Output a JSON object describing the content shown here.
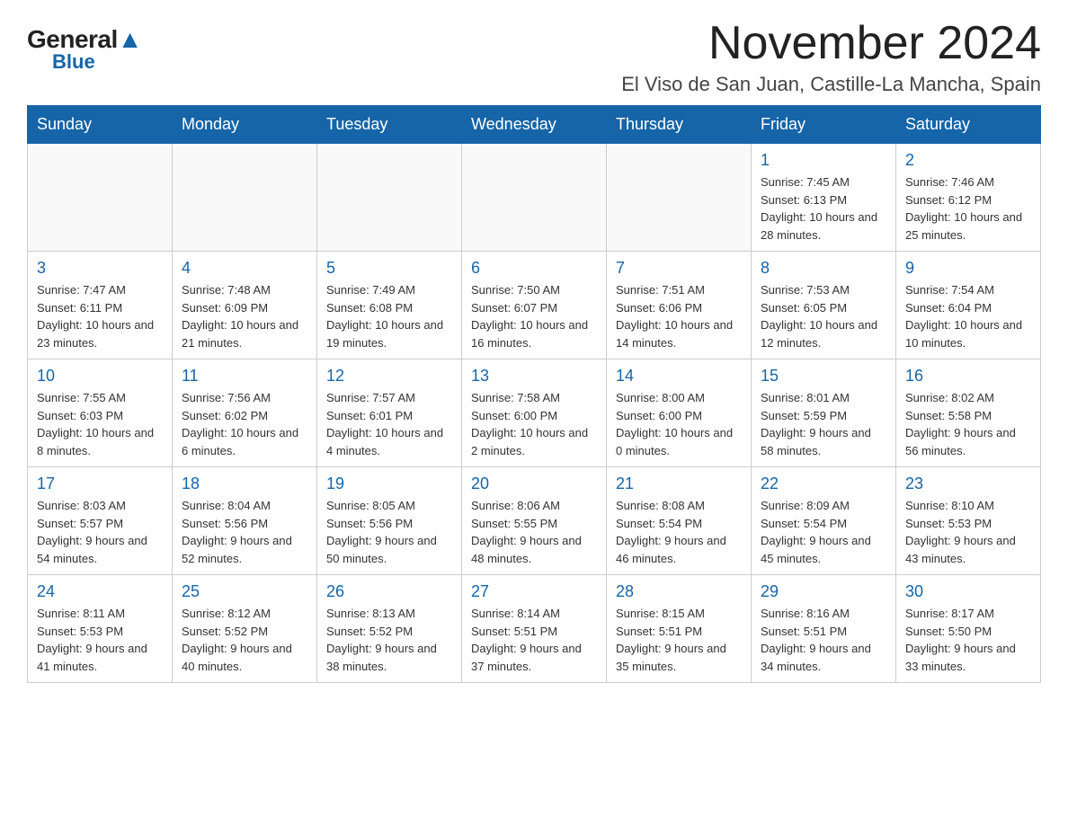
{
  "header": {
    "logo_general": "General",
    "logo_blue": "Blue",
    "main_title": "November 2024",
    "subtitle": "El Viso de San Juan, Castille-La Mancha, Spain"
  },
  "calendar": {
    "days_of_week": [
      "Sunday",
      "Monday",
      "Tuesday",
      "Wednesday",
      "Thursday",
      "Friday",
      "Saturday"
    ],
    "weeks": [
      [
        {
          "day": "",
          "info": ""
        },
        {
          "day": "",
          "info": ""
        },
        {
          "day": "",
          "info": ""
        },
        {
          "day": "",
          "info": ""
        },
        {
          "day": "",
          "info": ""
        },
        {
          "day": "1",
          "info": "Sunrise: 7:45 AM\nSunset: 6:13 PM\nDaylight: 10 hours and 28 minutes."
        },
        {
          "day": "2",
          "info": "Sunrise: 7:46 AM\nSunset: 6:12 PM\nDaylight: 10 hours and 25 minutes."
        }
      ],
      [
        {
          "day": "3",
          "info": "Sunrise: 7:47 AM\nSunset: 6:11 PM\nDaylight: 10 hours and 23 minutes."
        },
        {
          "day": "4",
          "info": "Sunrise: 7:48 AM\nSunset: 6:09 PM\nDaylight: 10 hours and 21 minutes."
        },
        {
          "day": "5",
          "info": "Sunrise: 7:49 AM\nSunset: 6:08 PM\nDaylight: 10 hours and 19 minutes."
        },
        {
          "day": "6",
          "info": "Sunrise: 7:50 AM\nSunset: 6:07 PM\nDaylight: 10 hours and 16 minutes."
        },
        {
          "day": "7",
          "info": "Sunrise: 7:51 AM\nSunset: 6:06 PM\nDaylight: 10 hours and 14 minutes."
        },
        {
          "day": "8",
          "info": "Sunrise: 7:53 AM\nSunset: 6:05 PM\nDaylight: 10 hours and 12 minutes."
        },
        {
          "day": "9",
          "info": "Sunrise: 7:54 AM\nSunset: 6:04 PM\nDaylight: 10 hours and 10 minutes."
        }
      ],
      [
        {
          "day": "10",
          "info": "Sunrise: 7:55 AM\nSunset: 6:03 PM\nDaylight: 10 hours and 8 minutes."
        },
        {
          "day": "11",
          "info": "Sunrise: 7:56 AM\nSunset: 6:02 PM\nDaylight: 10 hours and 6 minutes."
        },
        {
          "day": "12",
          "info": "Sunrise: 7:57 AM\nSunset: 6:01 PM\nDaylight: 10 hours and 4 minutes."
        },
        {
          "day": "13",
          "info": "Sunrise: 7:58 AM\nSunset: 6:00 PM\nDaylight: 10 hours and 2 minutes."
        },
        {
          "day": "14",
          "info": "Sunrise: 8:00 AM\nSunset: 6:00 PM\nDaylight: 10 hours and 0 minutes."
        },
        {
          "day": "15",
          "info": "Sunrise: 8:01 AM\nSunset: 5:59 PM\nDaylight: 9 hours and 58 minutes."
        },
        {
          "day": "16",
          "info": "Sunrise: 8:02 AM\nSunset: 5:58 PM\nDaylight: 9 hours and 56 minutes."
        }
      ],
      [
        {
          "day": "17",
          "info": "Sunrise: 8:03 AM\nSunset: 5:57 PM\nDaylight: 9 hours and 54 minutes."
        },
        {
          "day": "18",
          "info": "Sunrise: 8:04 AM\nSunset: 5:56 PM\nDaylight: 9 hours and 52 minutes."
        },
        {
          "day": "19",
          "info": "Sunrise: 8:05 AM\nSunset: 5:56 PM\nDaylight: 9 hours and 50 minutes."
        },
        {
          "day": "20",
          "info": "Sunrise: 8:06 AM\nSunset: 5:55 PM\nDaylight: 9 hours and 48 minutes."
        },
        {
          "day": "21",
          "info": "Sunrise: 8:08 AM\nSunset: 5:54 PM\nDaylight: 9 hours and 46 minutes."
        },
        {
          "day": "22",
          "info": "Sunrise: 8:09 AM\nSunset: 5:54 PM\nDaylight: 9 hours and 45 minutes."
        },
        {
          "day": "23",
          "info": "Sunrise: 8:10 AM\nSunset: 5:53 PM\nDaylight: 9 hours and 43 minutes."
        }
      ],
      [
        {
          "day": "24",
          "info": "Sunrise: 8:11 AM\nSunset: 5:53 PM\nDaylight: 9 hours and 41 minutes."
        },
        {
          "day": "25",
          "info": "Sunrise: 8:12 AM\nSunset: 5:52 PM\nDaylight: 9 hours and 40 minutes."
        },
        {
          "day": "26",
          "info": "Sunrise: 8:13 AM\nSunset: 5:52 PM\nDaylight: 9 hours and 38 minutes."
        },
        {
          "day": "27",
          "info": "Sunrise: 8:14 AM\nSunset: 5:51 PM\nDaylight: 9 hours and 37 minutes."
        },
        {
          "day": "28",
          "info": "Sunrise: 8:15 AM\nSunset: 5:51 PM\nDaylight: 9 hours and 35 minutes."
        },
        {
          "day": "29",
          "info": "Sunrise: 8:16 AM\nSunset: 5:51 PM\nDaylight: 9 hours and 34 minutes."
        },
        {
          "day": "30",
          "info": "Sunrise: 8:17 AM\nSunset: 5:50 PM\nDaylight: 9 hours and 33 minutes."
        }
      ]
    ]
  }
}
